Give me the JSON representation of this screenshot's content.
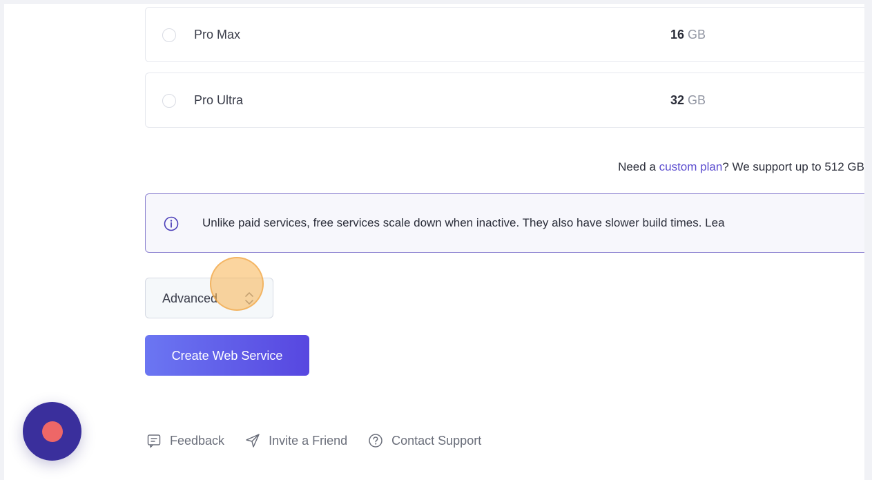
{
  "plans": [
    {
      "name": "Pro Max",
      "ram_value": "16",
      "ram_unit": "GB"
    },
    {
      "name": "Pro Ultra",
      "ram_value": "32",
      "ram_unit": "GB"
    }
  ],
  "custom": {
    "prefix": "Need a ",
    "link": "custom plan",
    "suffix": "? We support up to 512 GB"
  },
  "info": {
    "text": "Unlike paid services, free services scale down when inactive. They also have slower build times. Lea"
  },
  "advanced": {
    "label": "Advanced"
  },
  "create": {
    "label": "Create Web Service"
  },
  "footer": {
    "feedback": "Feedback",
    "invite": "Invite a Friend",
    "support": "Contact Support"
  },
  "colors": {
    "accent": "#5b4ccf",
    "button_start": "#6b76f2",
    "button_end": "#5747e0",
    "fab": "#3a2f9c",
    "fab_dot": "#ee6767"
  }
}
